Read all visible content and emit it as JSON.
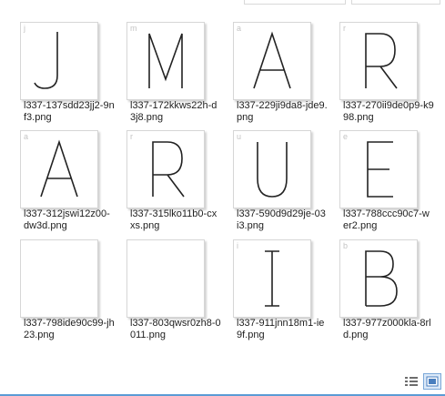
{
  "files": [
    {
      "name": "l337-137sdd23jj2-9nf3.png",
      "thumb_letter": "j",
      "glyph": "J"
    },
    {
      "name": "l337-172kkws22h-d3j8.png",
      "thumb_letter": "m",
      "glyph": "M"
    },
    {
      "name": "l337-229ji9da8-jde9.png",
      "thumb_letter": "a",
      "glyph": "A"
    },
    {
      "name": "l337-270ii9de0p9-k998.png",
      "thumb_letter": "r",
      "glyph": "R"
    },
    {
      "name": "l337-312jswi12z00-dw3d.png",
      "thumb_letter": "a",
      "glyph": "A"
    },
    {
      "name": "l337-315lko11b0-cxxs.png",
      "thumb_letter": "r",
      "glyph": "R"
    },
    {
      "name": "l337-590d9d29je-03i3.png",
      "thumb_letter": "u",
      "glyph": "U"
    },
    {
      "name": "l337-788ccc90c7-wer2.png",
      "thumb_letter": "e",
      "glyph": "E"
    },
    {
      "name": "l337-798ide90c99-jh23.png",
      "thumb_letter": "",
      "glyph": ""
    },
    {
      "name": "l337-803qwsr0zh8-0011.png",
      "thumb_letter": "",
      "glyph": ""
    },
    {
      "name": "l337-911jnn18m1-ie9f.png",
      "thumb_letter": "i",
      "glyph": "I"
    },
    {
      "name": "l337-977z000kla-8rld.png",
      "thumb_letter": "b",
      "glyph": "B"
    }
  ],
  "status": {
    "details_view_icon": "details-view-icon",
    "large_icons_view_icon": "large-icons-view-icon"
  },
  "colors": {
    "accent": "#5b9bd5",
    "thumb_border": "#d6d6d6",
    "glyph_stroke": "#222222"
  }
}
